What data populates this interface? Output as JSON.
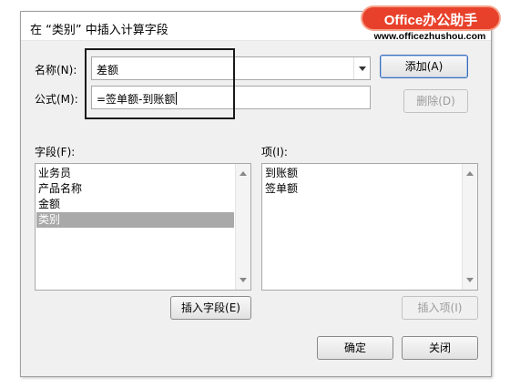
{
  "dialog": {
    "title": "在 “类别” 中插入计算字段",
    "name_label": "名称(N):",
    "formula_label": "公式(M):",
    "name_value": "差额",
    "formula_value": "=签单额-到账额",
    "add_button": "添加(A)",
    "delete_button": "删除(D)",
    "fields_label": "字段(F):",
    "items_label": "项(I):",
    "fields": [
      "业务员",
      "产品名称",
      "金额",
      "类别"
    ],
    "selected_field_index": 3,
    "items": [
      "到账额",
      "签单额"
    ],
    "insert_field_button": "插入字段(E)",
    "insert_item_button": "插入项(I)",
    "ok_button": "确定",
    "close_button": "关闭"
  },
  "watermark": {
    "title": "Office办公助手",
    "url": "www.officezhushou.com"
  },
  "colors": {
    "watermark_red": "#e8412b",
    "selection_gray": "#a9a9a9",
    "dialog_bg": "#f0f0f0"
  }
}
